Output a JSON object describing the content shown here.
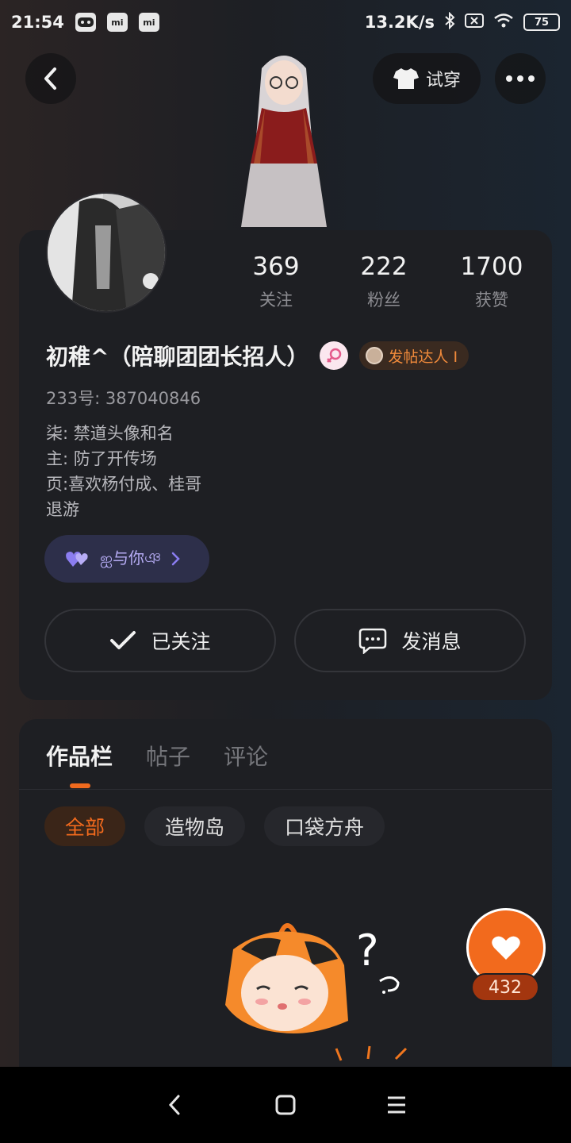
{
  "status_bar": {
    "time": "21:54",
    "network_speed": "13.2K/s",
    "battery": "75",
    "icons": [
      "game-icon",
      "mi-icon",
      "mi-icon",
      "bluetooth-icon",
      "no-sim-icon",
      "wifi-icon",
      "battery-icon"
    ]
  },
  "header": {
    "tryon_label": "试穿"
  },
  "profile": {
    "stats": [
      {
        "value": "369",
        "label": "关注"
      },
      {
        "value": "222",
        "label": "粉丝"
      },
      {
        "value": "1700",
        "label": "获赞"
      }
    ],
    "nickname": "初稚^（陪聊团团长招人）",
    "badge_label": "发帖达人 I",
    "uid": "233号: 387040846",
    "bio": [
      "柒: 禁道头像和名",
      "主: 防了开传场",
      "页:喜欢杨付成、桂哥",
      "退游"
    ],
    "ship_label": "ஐ与你ঞ",
    "follow_label": "已关注",
    "message_label": "发消息"
  },
  "works": {
    "tabs": [
      "作品栏",
      "帖子",
      "评论"
    ],
    "active_tab": 0,
    "chips": [
      "全部",
      "造物岛",
      "口袋方舟"
    ],
    "active_chip": 0,
    "like_count": "432"
  },
  "colors": {
    "accent": "#f26a1d",
    "card": "#1e1f23",
    "ship_purple": "#b7adf6"
  }
}
